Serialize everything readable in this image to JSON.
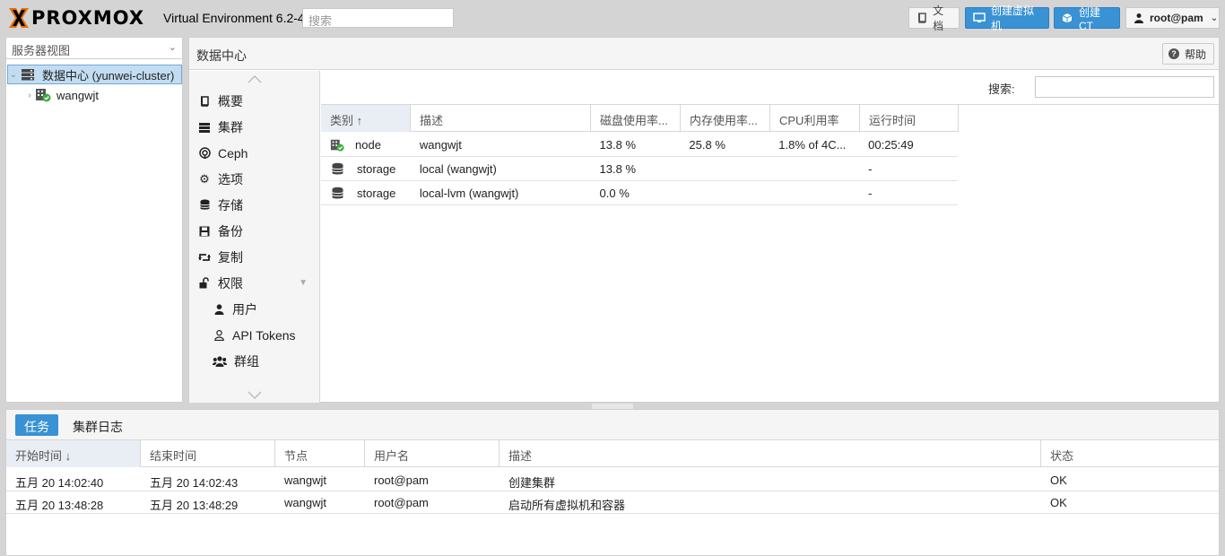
{
  "header": {
    "logo_text": "PROXMOX",
    "version": "Virtual Environment 6.2-4",
    "search_placeholder": "搜索",
    "buttons": {
      "docs": "文档",
      "create_vm": "创建虚拟机",
      "create_ct": "创建CT",
      "user": "root@pam"
    }
  },
  "sidebar": {
    "view_selector": "服务器视图",
    "tree": [
      {
        "label": "数据中心 (yunwei-cluster)",
        "selected": true
      },
      {
        "label": "wangwjt",
        "selected": false
      }
    ]
  },
  "datacenter": {
    "title": "数据中心",
    "help": "帮助",
    "nav": [
      {
        "label": "概要",
        "icon": "book-icon"
      },
      {
        "label": "集群",
        "icon": "server-icon"
      },
      {
        "label": "Ceph",
        "icon": "ceph-icon"
      },
      {
        "label": "选项",
        "icon": "gear-icon"
      },
      {
        "label": "存储",
        "icon": "database-icon"
      },
      {
        "label": "备份",
        "icon": "floppy-icon"
      },
      {
        "label": "复制",
        "icon": "retweet-icon"
      },
      {
        "label": "权限",
        "icon": "unlock-icon"
      },
      {
        "label": "用户",
        "icon": "user-icon"
      },
      {
        "label": "API Tokens",
        "icon": "user-outline-icon"
      },
      {
        "label": "群组",
        "icon": "users-icon"
      }
    ],
    "search_label": "搜索:",
    "columns": [
      "类别 ↑",
      "描述",
      "磁盘使用率...",
      "内存使用率...",
      "CPU利用率",
      "运行时间"
    ],
    "rows": [
      {
        "type": "node",
        "desc": "wangwjt",
        "disk": "13.8 %",
        "mem": "25.8 %",
        "cpu": "1.8% of 4C...",
        "uptime": "00:25:49",
        "icon": "node-online-icon"
      },
      {
        "type": "storage",
        "desc": "local (wangwjt)",
        "disk": "13.8 %",
        "mem": "",
        "cpu": "",
        "uptime": "-",
        "icon": "database-icon"
      },
      {
        "type": "storage",
        "desc": "local-lvm (wangwjt)",
        "disk": "0.0 %",
        "mem": "",
        "cpu": "",
        "uptime": "-",
        "icon": "database-icon"
      }
    ]
  },
  "tasks": {
    "tabs": [
      "任务",
      "集群日志"
    ],
    "columns": [
      "开始时间 ↓",
      "结束时间",
      "节点",
      "用户名",
      "描述",
      "状态"
    ],
    "rows": [
      {
        "start": "五月 20 14:02:40",
        "end": "五月 20 14:02:43",
        "node": "wangwjt",
        "user": "root@pam",
        "desc": "创建集群",
        "status": "OK"
      },
      {
        "start": "五月 20 13:48:28",
        "end": "五月 20 13:48:29",
        "node": "wangwjt",
        "user": "root@pam",
        "desc": "启动所有虚拟机和容器",
        "status": "OK"
      }
    ]
  },
  "colors": {
    "accent": "#3892d4",
    "selected_row": "#c2ddf2",
    "online_green": "#3cae3c"
  }
}
